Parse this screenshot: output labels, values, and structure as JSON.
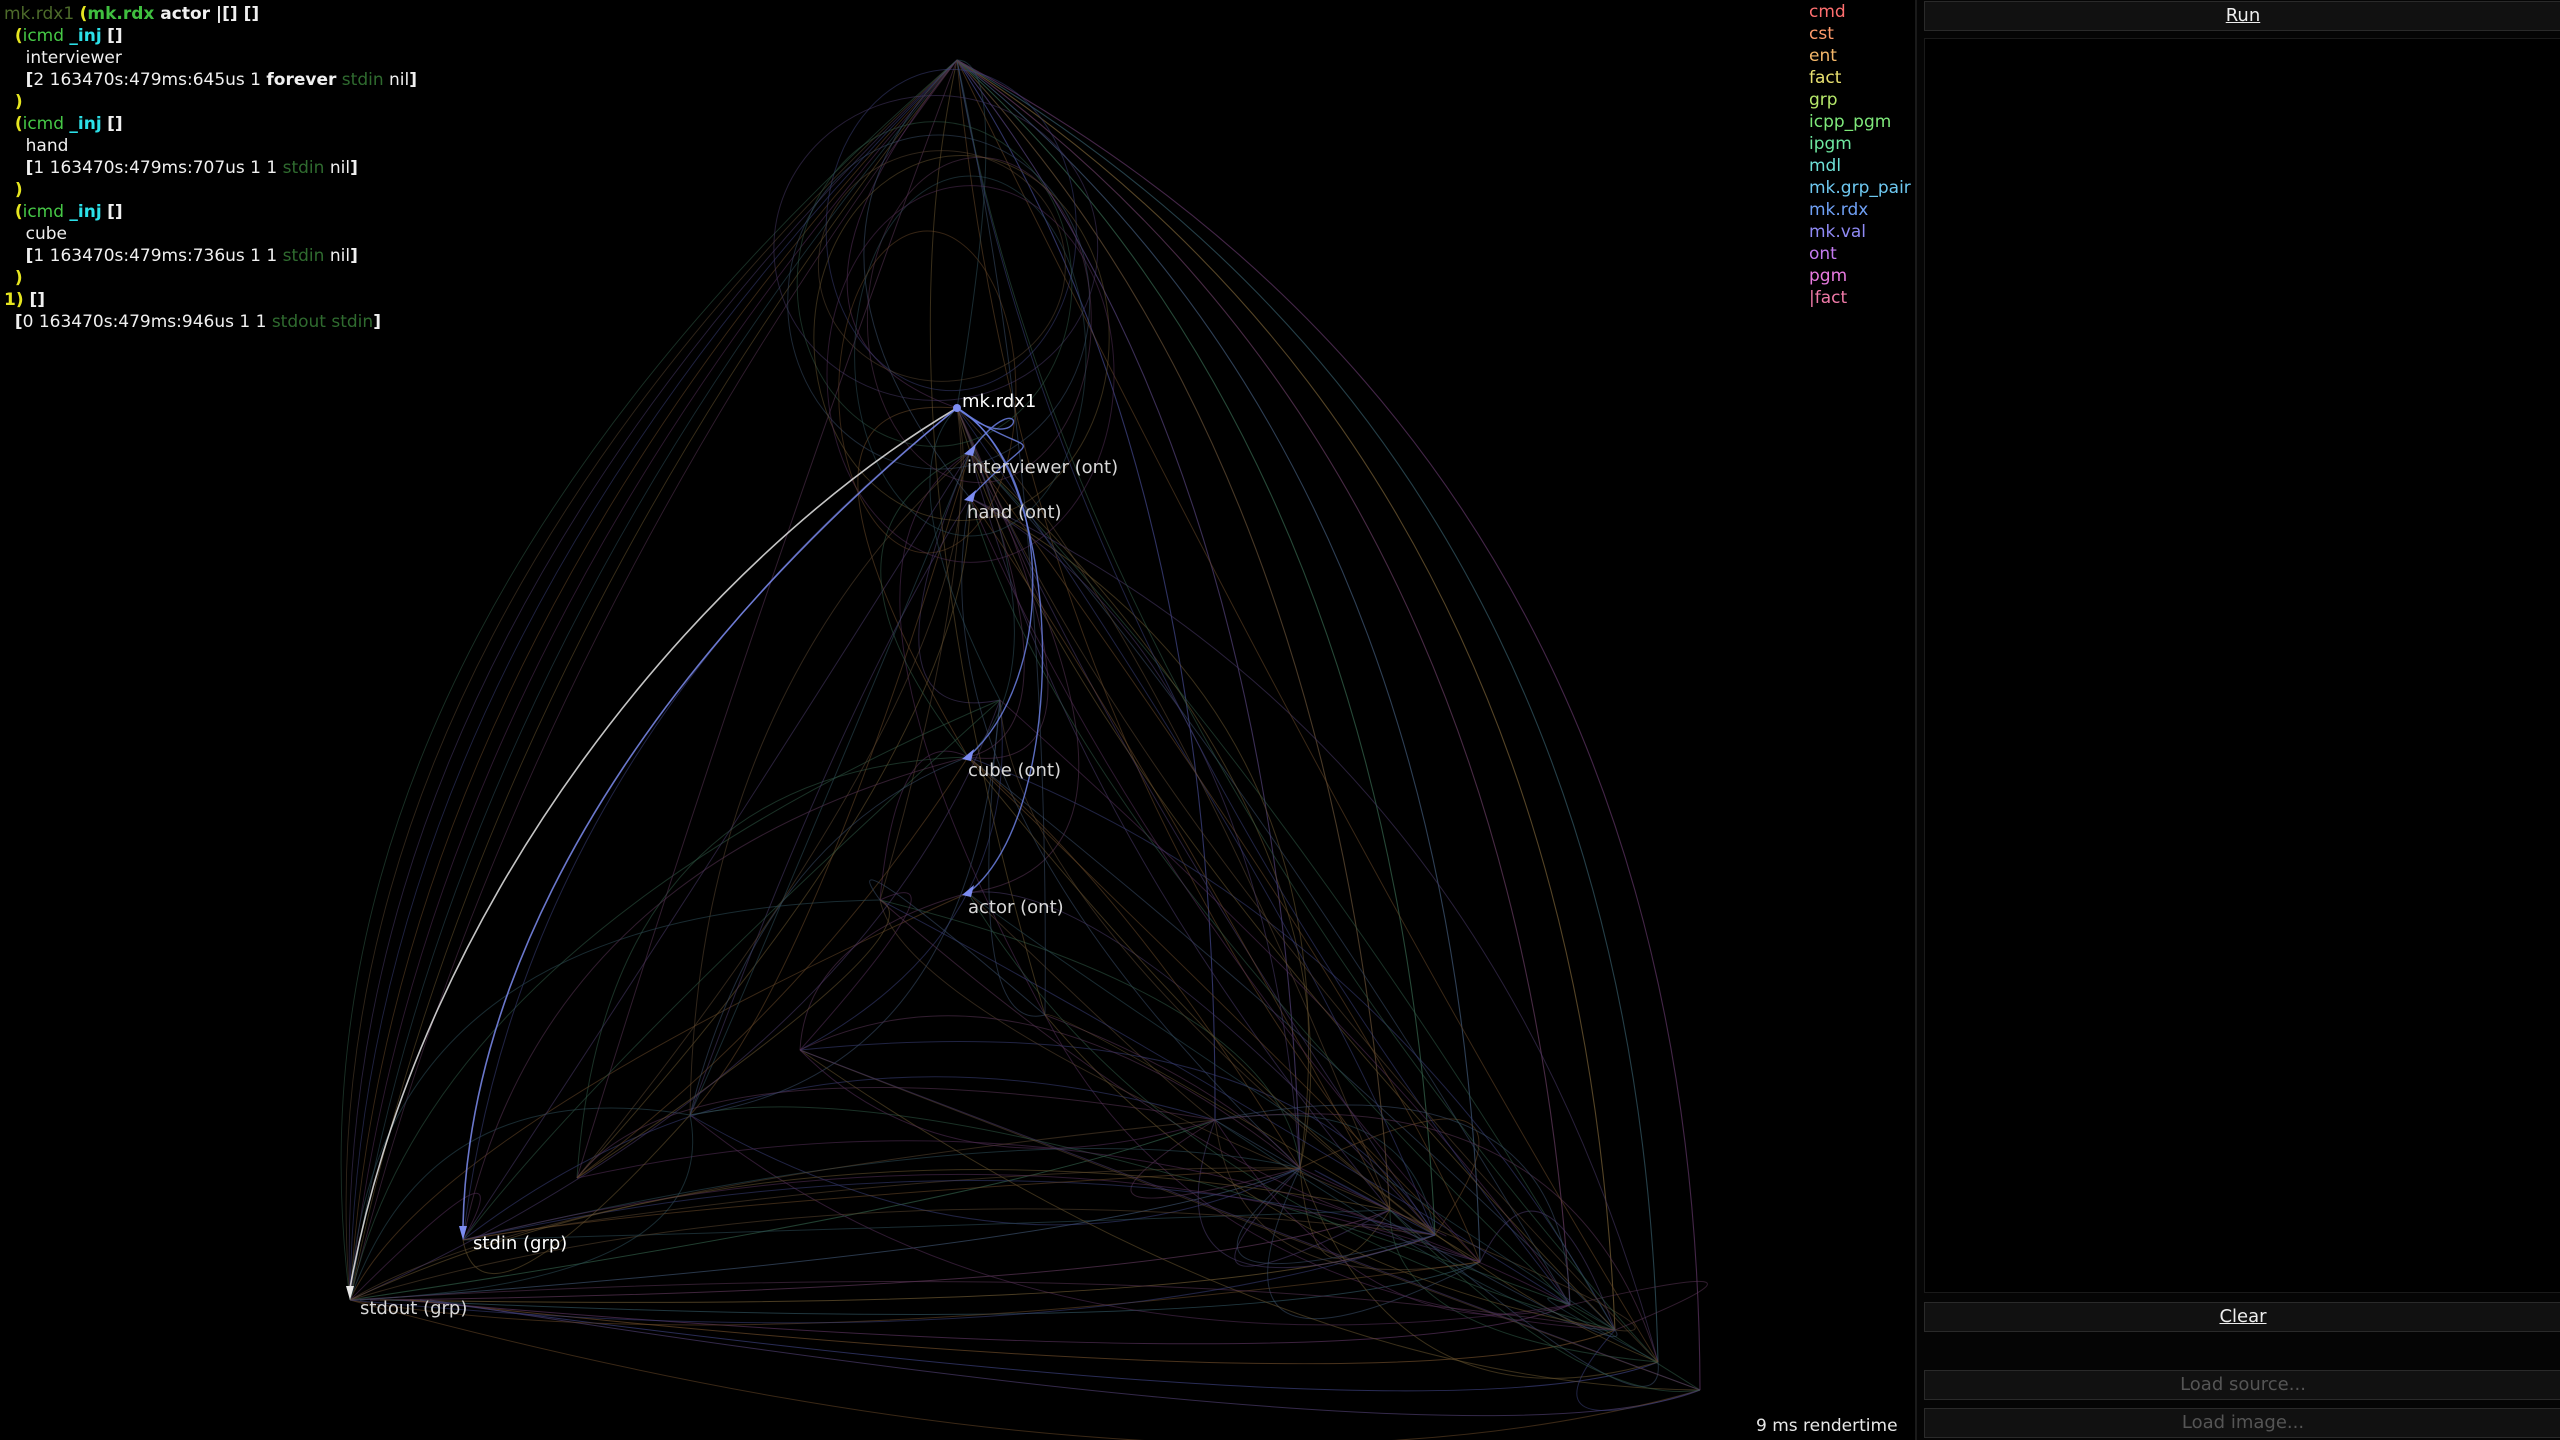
{
  "code": {
    "line1": {
      "prefix": "mk.rdx1",
      "open": "(",
      "kw": "mk.rdx",
      "rest": " actor |[] []"
    },
    "blocks": [
      {
        "paren": "(",
        "icmd": "icmd",
        "inj": "_inj",
        "brk": "[]",
        "name": "interviewer",
        "rec_open": "[",
        "rec_vals": "2 163470s:479ms:645us 1 ",
        "rec_bold": "forever",
        "rec_dim": " stdin",
        "rec_end": " nil",
        "rec_close": "]",
        "close": ")"
      },
      {
        "paren": "(",
        "icmd": "icmd",
        "inj": "_inj",
        "brk": "[]",
        "name": "hand",
        "rec_open": "[",
        "rec_vals": "1 163470s:479ms:707us 1 1",
        "rec_bold": "",
        "rec_dim": " stdin",
        "rec_end": " nil",
        "rec_close": "]",
        "close": ")"
      },
      {
        "paren": "(",
        "icmd": "icmd",
        "inj": "_inj",
        "brk": "[]",
        "name": "cube",
        "rec_open": "[",
        "rec_vals": "1 163470s:479ms:736us 1 1",
        "rec_bold": "",
        "rec_dim": " stdin",
        "rec_end": " nil",
        "rec_close": "]",
        "close": ")"
      }
    ],
    "tail1_a": "1)",
    "tail1_b": " []",
    "tail2_open": "[",
    "tail2_vals": "0 163470s:479ms:946us 1 1 ",
    "tail2_dim": "stdout stdin",
    "tail2_close": "]"
  },
  "graph_nodes": [
    {
      "id": "mk-rdx1",
      "label": "mk.rdx1",
      "color": "#ffffff"
    },
    {
      "id": "interviewer",
      "label": "interviewer (ont)",
      "color": "#cfcfcf"
    },
    {
      "id": "hand",
      "label": "hand (ont)",
      "color": "#cfcfcf"
    },
    {
      "id": "cube",
      "label": "cube (ont)",
      "color": "#cfcfcf"
    },
    {
      "id": "actor",
      "label": "actor (ont)",
      "color": "#cfcfcf"
    },
    {
      "id": "stdin",
      "label": "stdin (grp)",
      "color": "#ffffff"
    },
    {
      "id": "stdout",
      "label": "stdout (grp)",
      "color": "#cfcfcf"
    }
  ],
  "legend": [
    {
      "label": "cmd",
      "color": "#ff6f6f"
    },
    {
      "label": "cst",
      "color": "#ff9a6a"
    },
    {
      "label": "ent",
      "color": "#f5b86a"
    },
    {
      "label": "fact",
      "color": "#e8e070"
    },
    {
      "label": "grp",
      "color": "#b6e86a"
    },
    {
      "label": "icpp_pgm",
      "color": "#7ee87a"
    },
    {
      "label": "ipgm",
      "color": "#6ee8a0"
    },
    {
      "label": "mdl",
      "color": "#6ee0d6"
    },
    {
      "label": "mk.grp_pair",
      "color": "#6ec8f0"
    },
    {
      "label": "mk.rdx",
      "color": "#6fa0f5"
    },
    {
      "label": "mk.val",
      "color": "#8f8af5"
    },
    {
      "label": "ont",
      "color": "#c47af0"
    },
    {
      "label": "pgm",
      "color": "#e87ae0"
    },
    {
      "label": "|fact",
      "color": "#f07aa8"
    }
  ],
  "rendertime": "9 ms rendertime",
  "panel": {
    "run_label": "Run",
    "clear_label": "Clear",
    "load_source_label": "Load source...",
    "load_image_label": "Load image..."
  }
}
